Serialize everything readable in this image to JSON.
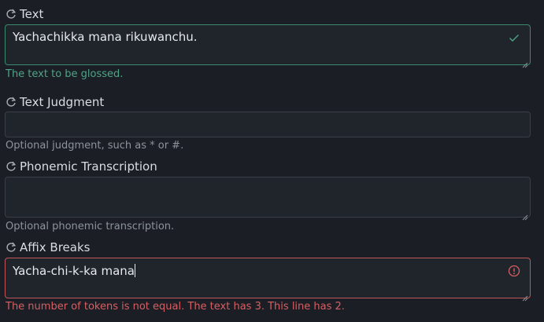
{
  "fields": [
    {
      "label": "Text",
      "value": "Yachachikka mana rikuwanchu.",
      "help": "The text to be glossed.",
      "status": "valid",
      "status_icon": "checkmark-icon"
    },
    {
      "label": "Text Judgment",
      "value": "",
      "help": "Optional judgment, such as * or #."
    },
    {
      "label": "Phonemic Transcription",
      "value": "",
      "help": "Optional phonemic transcription."
    },
    {
      "label": "Affix Breaks",
      "value": "Yacha-chi-k-ka mana",
      "help": "The number of tokens is not equal. The text has 3. This line has 2.",
      "status": "invalid",
      "status_icon": "error-circle-icon"
    }
  ],
  "colors": {
    "valid": "#3b8b6e",
    "invalid": "#c0575a",
    "background": "#1b1f25"
  },
  "icons": {
    "label_icon": "refresh-icon"
  }
}
